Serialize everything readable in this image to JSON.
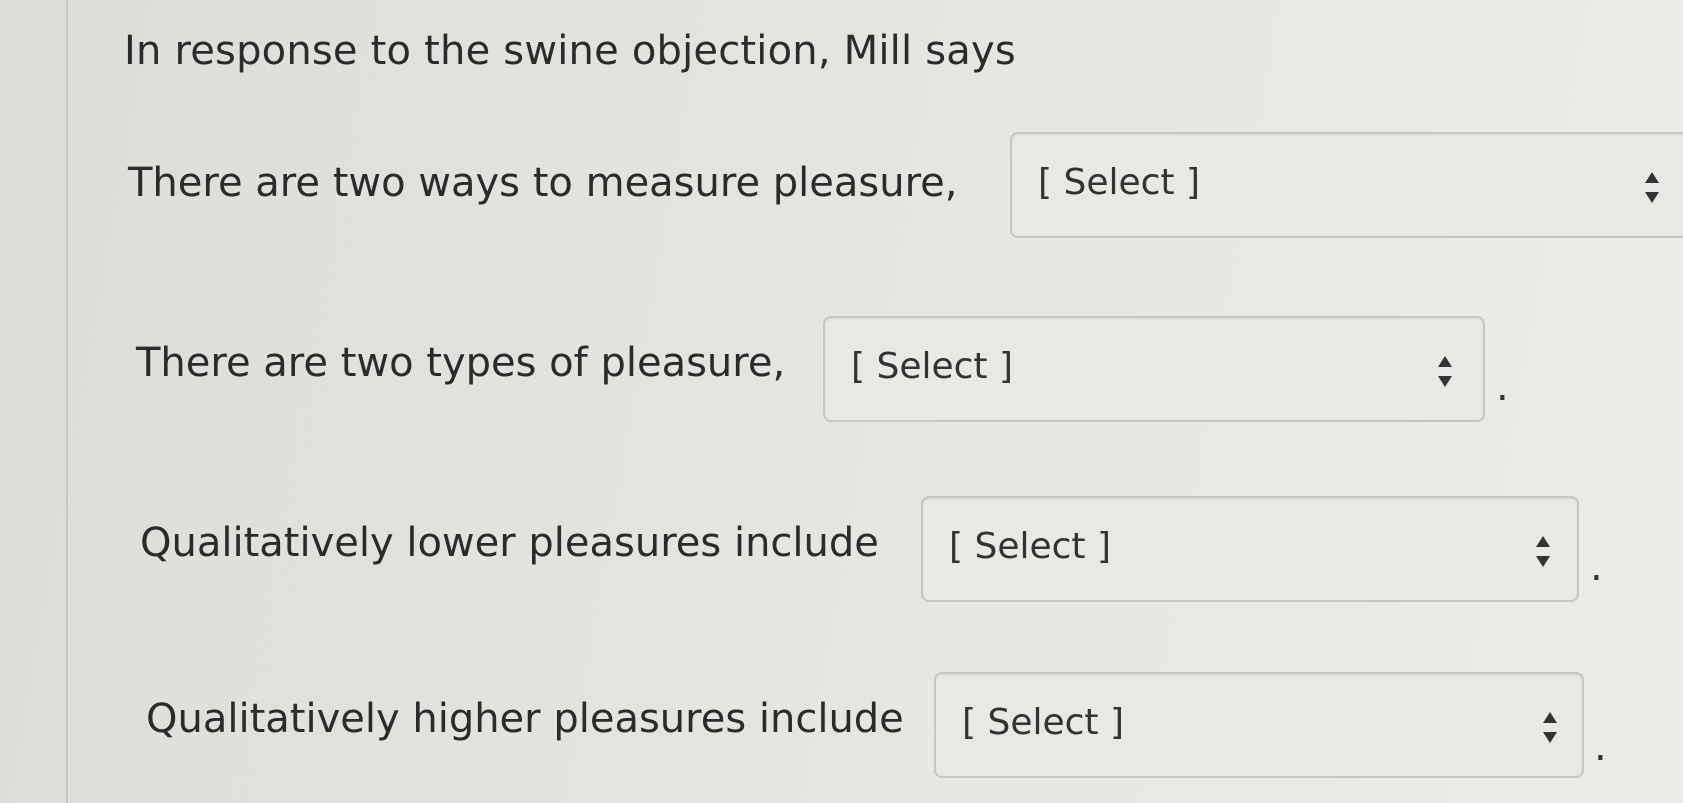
{
  "question": {
    "title": "In response to the swine objection, Mill says",
    "items": [
      {
        "label": "There are two ways to measure pleasure,",
        "select_value": "[ Select ]",
        "trailing": ""
      },
      {
        "label": "There are two types of pleasure,",
        "select_value": "[ Select ]",
        "trailing": "."
      },
      {
        "label": "Qualitatively lower pleasures include",
        "select_value": "[ Select ]",
        "trailing": "."
      },
      {
        "label": "Qualitatively higher pleasures include",
        "select_value": "[ Select ]",
        "trailing": "."
      }
    ]
  },
  "icons": {
    "spinner": "up-down-arrows-icon"
  },
  "colors": {
    "text": "#2b2b2b",
    "select_background": "#e8e8e4",
    "select_border": "#c6c5c0"
  }
}
